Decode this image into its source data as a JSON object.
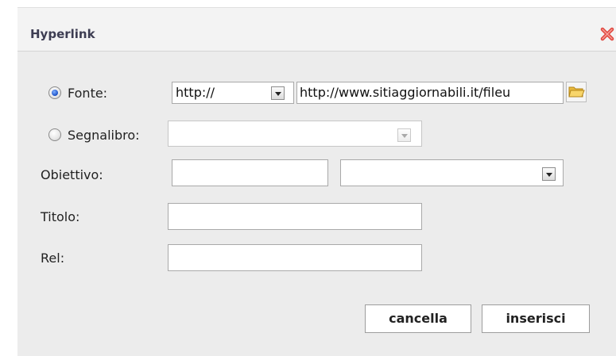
{
  "dialog": {
    "title": "Hyperlink"
  },
  "form": {
    "source_label": "Fonte:",
    "bookmark_label": "Segnalibro:",
    "target_label": "Obiettivo:",
    "title_label": "Titolo:",
    "rel_label": "Rel:",
    "protocol_value": "http://",
    "url_value": "http://www.sitiaggiornabili.it/fileu",
    "source_selected": true,
    "bookmark_selected": false,
    "bookmark_value": "",
    "target_value": "",
    "target_select_value": "",
    "title_value": "",
    "rel_value": ""
  },
  "buttons": {
    "cancel_label": "cancella",
    "insert_label": "inserisci"
  },
  "icons": {
    "close": "close-icon",
    "browse": "folder-icon"
  },
  "colors": {
    "title_text": "#3d3d52",
    "close_icon": "#e0463e",
    "radio_selected": "#1a4fc6"
  }
}
